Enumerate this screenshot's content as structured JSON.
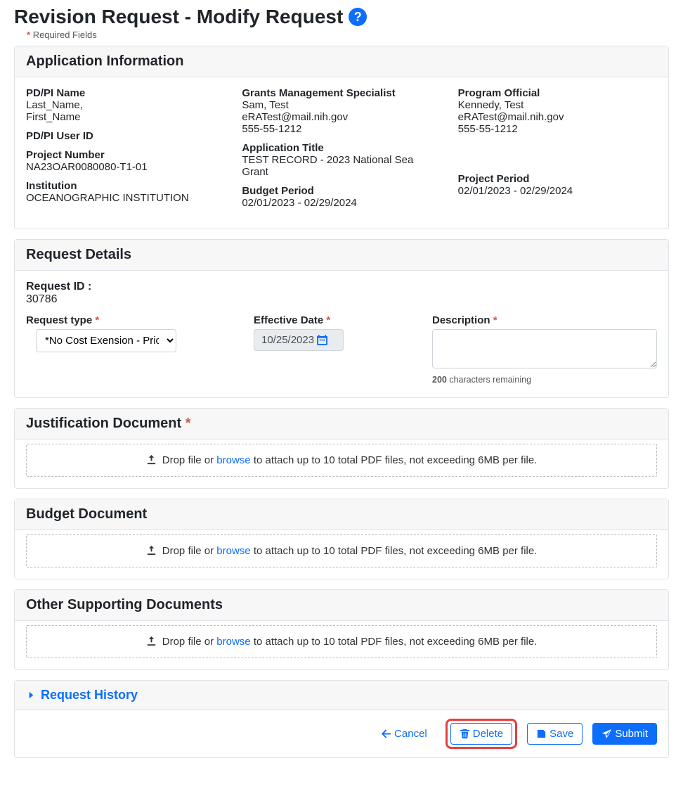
{
  "page": {
    "title": "Revision Request - Modify Request",
    "required_note": "Required Fields"
  },
  "appinfo": {
    "header": "Application Information",
    "cols": {
      "pdpi_name_label": "PD/PI Name",
      "pdpi_name_val1": "Last_Name,",
      "pdpi_name_val2": "First_Name",
      "pdpi_user_label": "PD/PI User ID",
      "project_num_label": "Project Number",
      "project_num_val": "NA23OAR0080080-T1-01",
      "institution_label": "Institution",
      "institution_val": "OCEANOGRAPHIC INSTITUTION",
      "gms_label": "Grants Management Specialist",
      "gms_name": "Sam, Test",
      "gms_email": "eRATest@mail.nih.gov",
      "gms_phone": "555-55-1212",
      "app_title_label": "Application Title",
      "app_title_val": "TEST RECORD - 2023 National Sea Grant",
      "budget_label": "Budget Period",
      "budget_val": "02/01/2023 - 02/29/2024",
      "po_label": "Program Official",
      "po_name": "Kennedy, Test",
      "po_email": "eRATest@mail.nih.gov",
      "po_phone": "555-55-1212",
      "project_period_label": "Project Period",
      "project_period_val": "02/01/2023 - 02/29/2024"
    }
  },
  "reqdetails": {
    "header": "Request Details",
    "id_label": "Request ID :",
    "id_val": "30786",
    "type_label": "Request type",
    "type_selected": "*No Cost Exension - Prior Approval",
    "effdate_label": "Effective Date",
    "effdate_val": "10/25/2023",
    "desc_label": "Description",
    "desc_chars": "200",
    "desc_chars_txt": "characters remaining"
  },
  "docs": {
    "just_header": "Justification Document",
    "budget_header": "Budget Document",
    "other_header": "Other Supporting Documents",
    "drop_prefix": "Drop file or ",
    "browse": "browse",
    "drop_suffix": " to attach up to 10 total PDF files, not exceeding 6MB per file."
  },
  "history": {
    "header": "Request History"
  },
  "buttons": {
    "cancel": "Cancel",
    "delete": "Delete",
    "save": "Save",
    "submit": "Submit"
  }
}
